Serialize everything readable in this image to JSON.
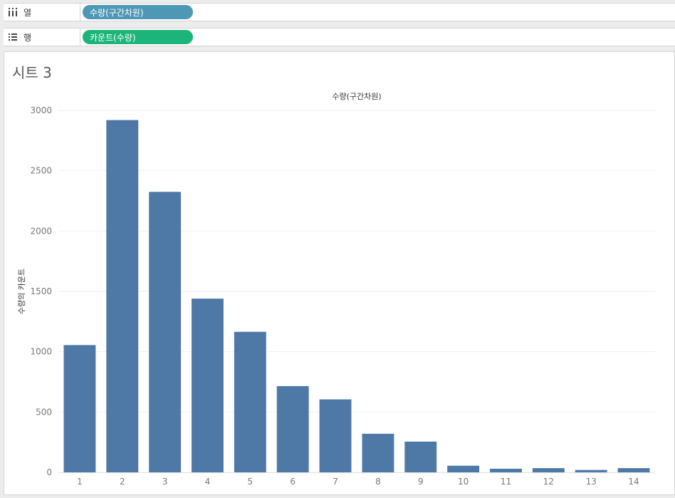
{
  "shelves": {
    "columns": {
      "label": "열",
      "icon": "columns-icon",
      "pill": "수량(구간차원)",
      "pill_color": "#4e98b5"
    },
    "rows": {
      "label": "행",
      "icon": "rows-icon",
      "pill": "카운트(수량)",
      "pill_color": "#1db47b"
    }
  },
  "sheet": {
    "title": "시트 3"
  },
  "chart_data": {
    "type": "bar",
    "title": "수량(구간차원)",
    "xlabel": "",
    "ylabel": "수량의 카운트",
    "categories": [
      "1",
      "2",
      "3",
      "4",
      "5",
      "6",
      "7",
      "8",
      "9",
      "10",
      "11",
      "12",
      "13",
      "14"
    ],
    "values": [
      1055,
      2920,
      2325,
      1440,
      1165,
      715,
      605,
      320,
      255,
      55,
      30,
      35,
      20,
      35
    ],
    "ylim": [
      0,
      3000
    ],
    "yticks": [
      "0",
      "500",
      "1000",
      "1500",
      "2000",
      "2500",
      "3000"
    ],
    "bar_color": "#4e79a7",
    "grid": true
  }
}
